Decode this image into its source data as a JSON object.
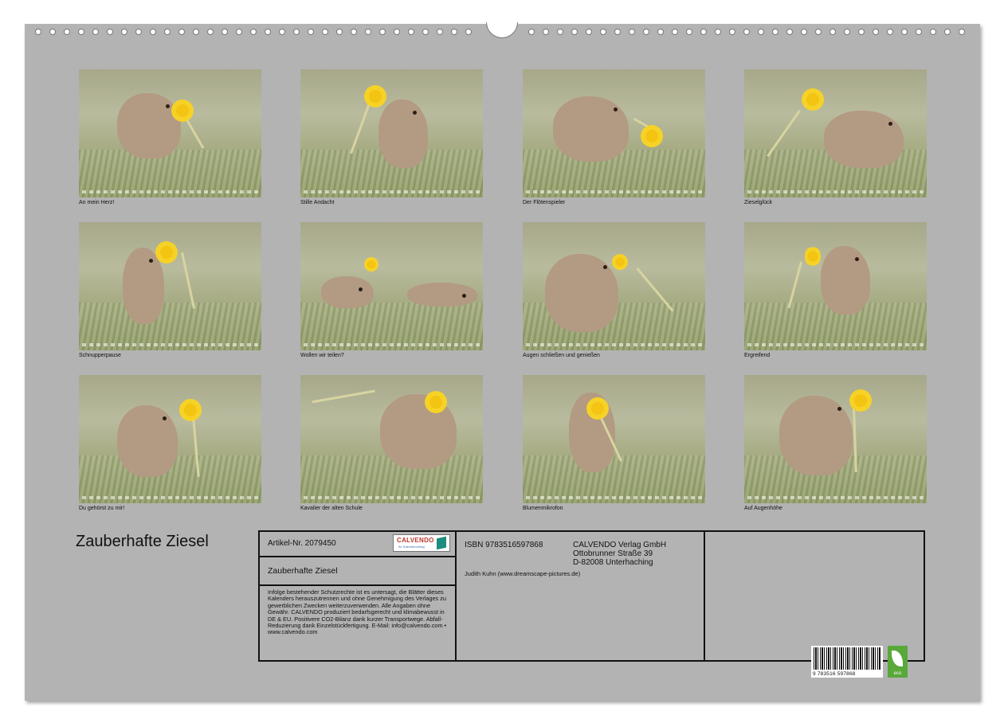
{
  "calendar": {
    "title": "Zauberhafte Ziesel",
    "months": [
      {
        "caption": "An mein Herz!"
      },
      {
        "caption": "Stille Andacht"
      },
      {
        "caption": "Der Flötenspieler"
      },
      {
        "caption": "Zieselglück"
      },
      {
        "caption": "Schnupperpause"
      },
      {
        "caption": "Wollen wir teilen?"
      },
      {
        "caption": "Augen schließen und genießen"
      },
      {
        "caption": "Ergreifend"
      },
      {
        "caption": "Du gehörst zu mir!"
      },
      {
        "caption": "Kavalier der alten Schule"
      },
      {
        "caption": "Blumenmikrofon"
      },
      {
        "caption": "Auf Augenhöhe"
      }
    ]
  },
  "info": {
    "article": "Artikel-Nr. 2079450",
    "logo_name": "CALVENDO",
    "logo_sub": "Ihr Kalenderverlag",
    "product_title": "Zauberhafte Ziesel",
    "legal": "Infolge bestehender Schutzrechte ist es untersagt, die Blätter dieses Kalenders herauszutrennen und ohne Genehmigung des Verlages zu gewerblichen Zwecken weiterzuverwenden. Alle Angaben ohne Gewähr. CALVENDO produziert bedarfsgerecht und klimabewusst in DE & EU. Positivere CO2-Bilanz dank kurzer Transportwege. Abfall-Reduzierung dank Einzelstückfertigung. E-Mail: info@calvendo.com • www.calvendo.com",
    "isbn": "ISBN 9783516597868",
    "publisher_line1": "CALVENDO Verlag GmbH",
    "publisher_line2": "Ottobrunner Straße 39",
    "publisher_line3": "D-82008 Unterhaching",
    "author": "Judith Kuhn (www.dreamscape-pictures.de)",
    "barcode_digits": "9  783516  597868",
    "eco_label": "eco"
  },
  "colors": {
    "sheet": "#b3b3b3",
    "flower": "#f7d226",
    "squirrel": "#b39a82",
    "eco": "#58a83a"
  }
}
